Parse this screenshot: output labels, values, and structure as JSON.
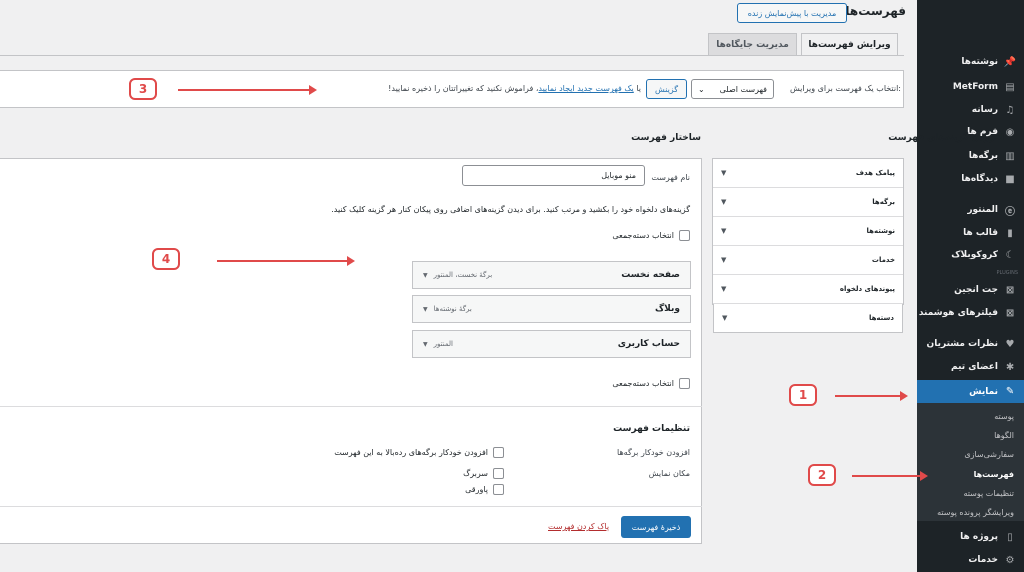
{
  "header": {
    "title": "فهرست‌ها",
    "preview_button": "مدیریت با پیش‌نمایش زنده"
  },
  "tabs": [
    {
      "label": "ویرایش فهرست‌ها",
      "active": true
    },
    {
      "label": "مدیریت جایگاه‌ها",
      "active": false
    }
  ],
  "select_bar": {
    "label": "انتخاب یک فهرست برای ویرایش:",
    "selected_menu": "فهرست اصلی",
    "choose_button": "گزینش",
    "or_text": "یا",
    "create_link": "یک فهرست جدید ایجاد نمایید",
    "reminder": "، فراموش نکنید که تغییراتتان را ذخیره نمایید!"
  },
  "add_items": {
    "title": "افزودن گزینه‌های فهرست",
    "sections": [
      "پیامک هدف",
      "برگه‌ها",
      "نوشته‌ها",
      "خدمات",
      "پیوندهای دلخواه",
      "دسته‌ها"
    ]
  },
  "structure": {
    "title": "ساختار فهرست",
    "name_label": "نام فهرست",
    "name_value": "منو موبایل",
    "instructions": "گزینه‌های دلخواه خود را بکشید و مرتب کنید. برای دیدن گزینه‌های اضافی روی پیکان کنار هر گزینه کلیک کنید.",
    "bulk_select": "انتخاب دسته‌جمعی",
    "items": [
      {
        "title": "صفحه نخست",
        "type": "برگهٔ نخست، المنتور"
      },
      {
        "title": "وبلاگ",
        "type": "برگهٔ نوشته‌ها"
      },
      {
        "title": "حساب کاربری",
        "type": "المنتور"
      }
    ]
  },
  "settings": {
    "title": "تنظیمات فهرست",
    "auto_add_label": "افزودن خودکار برگه‌ها",
    "auto_add_option": "افزودن خودکار برگه‌های رده‌بالا به این فهرست",
    "location_label": "مکان نمایش",
    "locations": [
      "سربرگ",
      "پاورقی"
    ]
  },
  "footer": {
    "save_button": "ذخیرهٔ فهرست",
    "delete_link": "پاک کردن فهرست"
  },
  "sidebar": {
    "items": [
      {
        "label": "نوشته‌ها",
        "icon": "pin-icon"
      },
      {
        "label": "MetForm",
        "icon": "form-icon"
      },
      {
        "label": "رسانه",
        "icon": "media-icon"
      },
      {
        "label": "فرم ها",
        "icon": "forms-icon"
      },
      {
        "label": "برگه‌ها",
        "icon": "page-icon"
      },
      {
        "label": "دیدگاه‌ها",
        "icon": "comment-icon"
      },
      {
        "label": "المنتور",
        "icon": "elementor-icon"
      },
      {
        "label": "قالب ها",
        "icon": "template-icon"
      },
      {
        "label": "کروکوبلاک",
        "icon": "moon-icon"
      },
      {
        "label": "جت انجین",
        "icon": "jet-icon"
      },
      {
        "label": "فیلترهای هوشمند",
        "icon": "jet-icon"
      },
      {
        "label": "نظرات مشتریان",
        "icon": "heart-icon"
      },
      {
        "label": "اعضای تیم",
        "icon": "person-icon"
      },
      {
        "label": "نمایش",
        "icon": "brush-icon"
      },
      {
        "label": "پروژه ها",
        "icon": "portfolio-icon"
      },
      {
        "label": "خدمات",
        "icon": "gear-icon"
      }
    ],
    "plugins_tag": "PLUGINS",
    "submenu": [
      "پوسته",
      "الگوها",
      "سفارشی‌سازی",
      "فهرست‌ها",
      "تنظیمات پوسته",
      "ویرایشگر پرونده پوسته"
    ]
  },
  "annotations": [
    "1",
    "2",
    "3",
    "4"
  ],
  "colors": {
    "accent": "#2271b1",
    "sidebar_bg": "#1d2327",
    "annotation": "#e04a4a"
  }
}
